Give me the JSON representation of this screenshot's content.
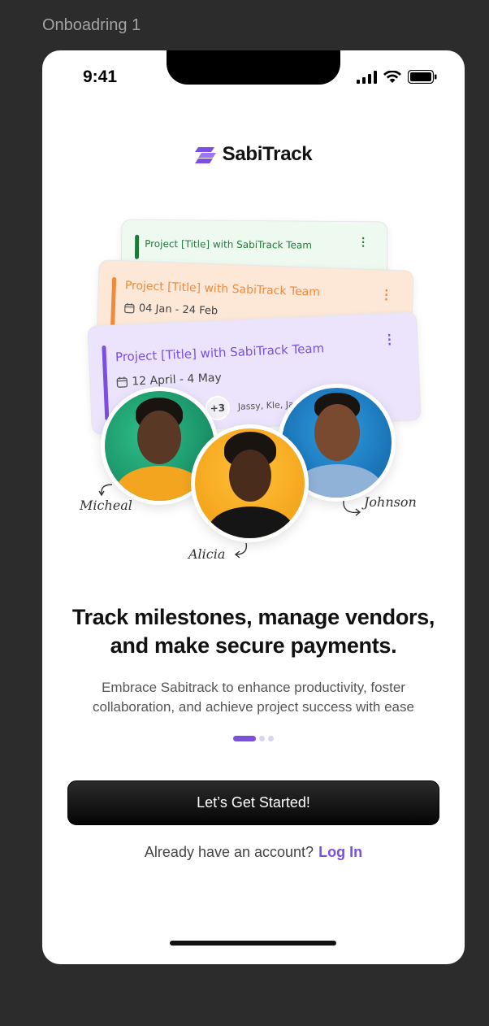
{
  "frame": {
    "label": "Onboadring 1"
  },
  "status_bar": {
    "time": "9:41"
  },
  "brand": {
    "name": "SabiTrack",
    "color": "#7b4fe0"
  },
  "cards": {
    "green": {
      "title": "Project [Title] with SabiTrack Team",
      "date": "",
      "color": "#1f7a3a"
    },
    "orange": {
      "title": "Project [Title] with SabiTrack Team",
      "date": "04 Jan - 24 Feb",
      "color": "#f08a3c"
    },
    "purple": {
      "title": "Project [Title] with SabiTrack Team",
      "date": "12 April - 4 May",
      "extra_count": "+3",
      "members": "Jassy, Kle, Jam",
      "color": "#7b4fe0"
    }
  },
  "people": [
    {
      "name": "Micheal"
    },
    {
      "name": "Alicia"
    },
    {
      "name": "Johnson"
    }
  ],
  "headline": "Track milestones, manage vendors, and make secure payments.",
  "subtext": "Embrace Sabitrack to enhance productivity, foster collaboration, and achieve project success with ease",
  "pagination": {
    "current": 1,
    "total": 3
  },
  "cta": {
    "label": "Let’s Get Started!"
  },
  "login": {
    "prompt": "Already have an account?",
    "link": "Log In"
  }
}
